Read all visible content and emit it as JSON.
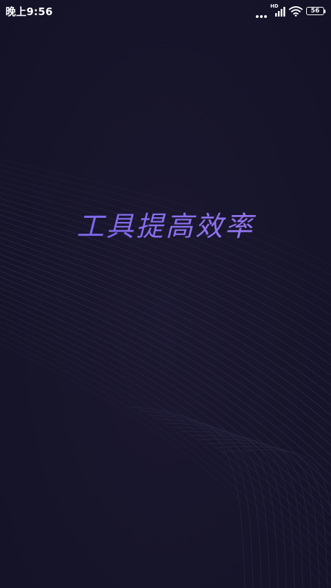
{
  "status_bar": {
    "time": "晚上9:56",
    "network_label": "HD",
    "battery_level": "56",
    "icons": [
      "more-dots-icon",
      "signal-icon",
      "wifi-icon",
      "battery-icon"
    ]
  },
  "splash": {
    "slogan": "工具提高效率"
  },
  "colors": {
    "background": "#16142a",
    "slogan_start": "#6f5ae8",
    "slogan_end": "#9a78ee",
    "wave_lines": "#2c2945"
  }
}
